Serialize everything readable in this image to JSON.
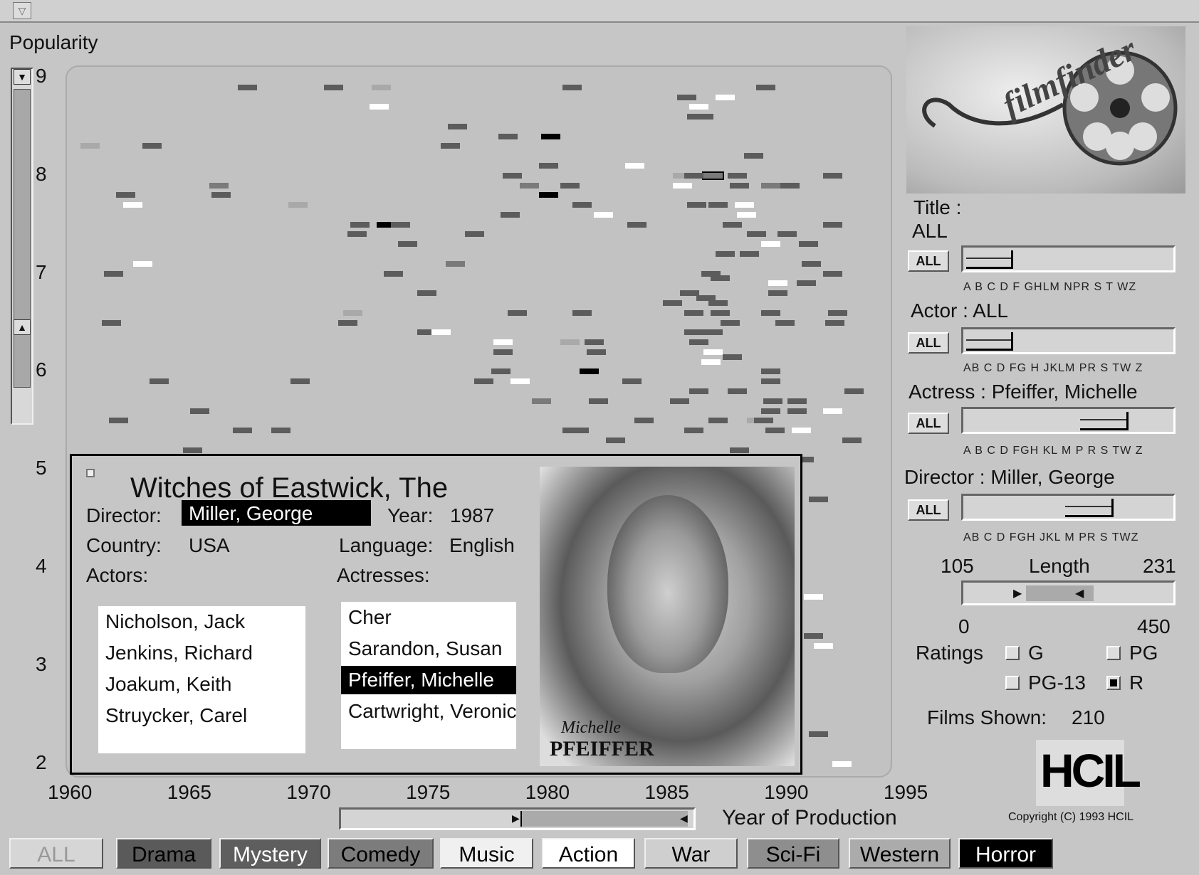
{
  "window": {
    "menu_icon": "dropdown-arrow-icon"
  },
  "chart_data": {
    "type": "scatter",
    "ylabel": "Popularity",
    "xlabel": "Year of Production",
    "xlim": [
      1960,
      1995
    ],
    "ylim": [
      2,
      9
    ],
    "x_ticks": [
      "1960",
      "1965",
      "1970",
      "1975",
      "1980",
      "1985",
      "1990",
      "1995"
    ],
    "y_ticks": [
      "9",
      "8",
      "7",
      "6",
      "5",
      "4",
      "3",
      "2"
    ],
    "shade_colors": {
      "d": "#5c5c5c",
      "m": "#7a7a7a",
      "l": "#a9a9a9",
      "w": "#ffffff",
      "k": "#000000"
    },
    "points": [
      [
        1960.8,
        8.3,
        "l"
      ],
      [
        1967.4,
        8.9,
        "d"
      ],
      [
        1971.0,
        8.9,
        "d"
      ],
      [
        1973.0,
        8.9,
        "l"
      ],
      [
        1972.9,
        8.7,
        "w"
      ],
      [
        1963.4,
        8.3,
        "d"
      ],
      [
        1962.3,
        7.8,
        "d"
      ],
      [
        1962.6,
        7.7,
        "w"
      ],
      [
        1966.2,
        7.9,
        "m"
      ],
      [
        1966.3,
        7.8,
        "d"
      ],
      [
        1969.5,
        7.7,
        "l"
      ],
      [
        1961.8,
        7.0,
        "d"
      ],
      [
        1963.0,
        7.1,
        "w"
      ],
      [
        1961.7,
        6.5,
        "d"
      ],
      [
        1963.7,
        5.9,
        "d"
      ],
      [
        1965.4,
        5.6,
        "d"
      ],
      [
        1962.0,
        5.5,
        "d"
      ],
      [
        1967.2,
        5.4,
        "d"
      ],
      [
        1968.8,
        5.4,
        "d"
      ],
      [
        1969.6,
        5.9,
        "d"
      ],
      [
        1965.1,
        5.2,
        "d"
      ],
      [
        1976.2,
        8.5,
        "d"
      ],
      [
        1975.9,
        8.3,
        "d"
      ],
      [
        1978.3,
        8.4,
        "d"
      ],
      [
        1980.1,
        8.4,
        "k"
      ],
      [
        1981.0,
        8.9,
        "d"
      ],
      [
        1980.0,
        8.1,
        "d"
      ],
      [
        1978.5,
        8.0,
        "d"
      ],
      [
        1979.2,
        7.9,
        "m"
      ],
      [
        1980.0,
        7.8,
        "k"
      ],
      [
        1980.9,
        7.9,
        "d"
      ],
      [
        1983.6,
        8.1,
        "w"
      ],
      [
        1978.4,
        7.6,
        "d"
      ],
      [
        1982.3,
        7.6,
        "w"
      ],
      [
        1983.7,
        7.5,
        "d"
      ],
      [
        1981.4,
        7.7,
        "d"
      ],
      [
        1973.2,
        7.5,
        "k"
      ],
      [
        1972.1,
        7.5,
        "d"
      ],
      [
        1972.0,
        7.4,
        "d"
      ],
      [
        1973.8,
        7.5,
        "d"
      ],
      [
        1974.1,
        7.3,
        "d"
      ],
      [
        1973.5,
        7.0,
        "d"
      ],
      [
        1976.9,
        7.4,
        "d"
      ],
      [
        1976.1,
        7.1,
        "m"
      ],
      [
        1974.9,
        6.8,
        "d"
      ],
      [
        1971.8,
        6.6,
        "l"
      ],
      [
        1971.6,
        6.5,
        "d"
      ],
      [
        1974.9,
        6.4,
        "d"
      ],
      [
        1975.5,
        6.4,
        "w"
      ],
      [
        1978.7,
        6.6,
        "d"
      ],
      [
        1981.4,
        6.6,
        "d"
      ],
      [
        1978.1,
        6.3,
        "w"
      ],
      [
        1978.1,
        6.2,
        "d"
      ],
      [
        1980.9,
        6.3,
        "l"
      ],
      [
        1981.9,
        6.3,
        "d"
      ],
      [
        1982.0,
        6.2,
        "d"
      ],
      [
        1981.7,
        6.0,
        "k"
      ],
      [
        1978.0,
        6.0,
        "d"
      ],
      [
        1977.3,
        5.9,
        "d"
      ],
      [
        1978.8,
        5.9,
        "w"
      ],
      [
        1979.7,
        5.7,
        "m"
      ],
      [
        1982.1,
        5.7,
        "d"
      ],
      [
        1983.5,
        5.9,
        "d"
      ],
      [
        1981.3,
        5.4,
        "d"
      ],
      [
        1981.0,
        5.4,
        "d"
      ],
      [
        1982.8,
        5.3,
        "d"
      ],
      [
        1984.0,
        5.5,
        "d"
      ],
      [
        1985.8,
        8.8,
        "d"
      ],
      [
        1986.3,
        8.7,
        "w"
      ],
      [
        1987.4,
        8.8,
        "w"
      ],
      [
        1989.1,
        8.9,
        "d"
      ],
      [
        1986.2,
        8.6,
        "d"
      ],
      [
        1986.5,
        8.6,
        "d"
      ],
      [
        1986.9,
        8.0,
        "m"
      ],
      [
        1988.6,
        8.2,
        "d"
      ],
      [
        1985.6,
        8.0,
        "l"
      ],
      [
        1986.1,
        8.0,
        "d"
      ],
      [
        1987.9,
        8.0,
        "d"
      ],
      [
        1991.9,
        8.0,
        "d"
      ],
      [
        1985.6,
        7.9,
        "w"
      ],
      [
        1988.0,
        7.9,
        "d"
      ],
      [
        1989.3,
        7.9,
        "m"
      ],
      [
        1990.1,
        7.9,
        "d"
      ],
      [
        1986.2,
        7.7,
        "d"
      ],
      [
        1987.1,
        7.7,
        "d"
      ],
      [
        1988.2,
        7.7,
        "w"
      ],
      [
        1988.3,
        7.6,
        "w"
      ],
      [
        1987.7,
        7.5,
        "d"
      ],
      [
        1988.7,
        7.4,
        "d"
      ],
      [
        1989.3,
        7.3,
        "w"
      ],
      [
        1990.0,
        7.4,
        "d"
      ],
      [
        1991.9,
        7.5,
        "d"
      ],
      [
        1990.9,
        7.3,
        "d"
      ],
      [
        1987.4,
        7.2,
        "d"
      ],
      [
        1988.4,
        7.2,
        "d"
      ],
      [
        1991.0,
        7.1,
        "d"
      ],
      [
        1991.9,
        7.0,
        "d"
      ],
      [
        1986.8,
        7.0,
        "d"
      ],
      [
        1987.2,
        6.95,
        "d"
      ],
      [
        1989.6,
        6.9,
        "w"
      ],
      [
        1990.8,
        6.9,
        "d"
      ],
      [
        1985.9,
        6.8,
        "d"
      ],
      [
        1989.6,
        6.8,
        "d"
      ],
      [
        1986.6,
        6.75,
        "d"
      ],
      [
        1985.2,
        6.7,
        "d"
      ],
      [
        1986.1,
        6.6,
        "d"
      ],
      [
        1987.1,
        6.7,
        "d"
      ],
      [
        1987.2,
        6.6,
        "d"
      ],
      [
        1989.3,
        6.6,
        "d"
      ],
      [
        1989.9,
        6.5,
        "d"
      ],
      [
        1992.1,
        6.6,
        "d"
      ],
      [
        1992.0,
        6.5,
        "d"
      ],
      [
        1987.6,
        6.5,
        "d"
      ],
      [
        1986.1,
        6.4,
        "d"
      ],
      [
        1986.9,
        6.4,
        "d"
      ],
      [
        1986.3,
        6.3,
        "d"
      ],
      [
        1986.9,
        6.2,
        "w"
      ],
      [
        1987.7,
        6.15,
        "d"
      ],
      [
        1986.8,
        6.1,
        "w"
      ],
      [
        1989.3,
        6.0,
        "d"
      ],
      [
        1989.3,
        5.9,
        "d"
      ],
      [
        1987.9,
        5.8,
        "d"
      ],
      [
        1985.5,
        5.7,
        "d"
      ],
      [
        1986.3,
        5.8,
        "d"
      ],
      [
        1989.4,
        5.7,
        "d"
      ],
      [
        1990.4,
        5.7,
        "d"
      ],
      [
        1990.4,
        5.6,
        "d"
      ],
      [
        1989.3,
        5.6,
        "d"
      ],
      [
        1991.9,
        5.6,
        "w"
      ],
      [
        1992.8,
        5.8,
        "d"
      ],
      [
        1988.7,
        5.5,
        "l"
      ],
      [
        1989.0,
        5.5,
        "d"
      ],
      [
        1989.5,
        5.4,
        "d"
      ],
      [
        1990.6,
        5.4,
        "w"
      ],
      [
        1987.1,
        5.5,
        "d"
      ],
      [
        1986.1,
        5.4,
        "d"
      ],
      [
        1992.7,
        5.3,
        "d"
      ],
      [
        1988.0,
        5.2,
        "d"
      ],
      [
        1990.7,
        5.1,
        "d"
      ],
      [
        1991.3,
        4.7,
        "d"
      ],
      [
        1991.1,
        3.7,
        "w"
      ],
      [
        1991.1,
        3.3,
        "d"
      ],
      [
        1991.5,
        3.2,
        "w"
      ],
      [
        1991.3,
        2.3,
        "d"
      ],
      [
        1992.3,
        2.0,
        "w"
      ]
    ],
    "selected_point": [
      1986.9,
      8.0
    ]
  },
  "details": {
    "title": "Witches of Eastwick, The",
    "director_label": "Director:",
    "director": "Miller, George",
    "year_label": "Year:",
    "year": "1987",
    "country_label": "Country:",
    "country": "USA",
    "language_label": "Language:",
    "language": "English",
    "actors_label": "Actors:",
    "actresses_label": "Actresses:",
    "actors": [
      "Nicholson, Jack",
      "Jenkins, Richard",
      "Joakum, Keith",
      "Struycker, Carel"
    ],
    "actresses": [
      "Cher",
      "Sarandon, Susan",
      "Pfeiffer, Michelle",
      "Cartwright, Veronica"
    ],
    "selected_actress": "Pfeiffer, Michelle",
    "photo_caption_1": "Michelle",
    "photo_caption_2": "PFEIFFER"
  },
  "logo": {
    "text": "filmfinder"
  },
  "filters": {
    "title_label": "Title :",
    "title_value": "ALL",
    "actor_label": "Actor : ALL",
    "actress_label": "Actress : Pfeiffer, Michelle",
    "director_label": "Director : Miller, George",
    "all_button": "ALL",
    "title_letters": "A B C D F GHLM NPR S  T  WZ",
    "actor_letters": "AB  C  D FG H JKLM  PR S  TW Z",
    "actress_letters": "A B  C  D FGH KL M  P R S  TW Z",
    "director_letters": "AB  C  D FGH JKL M  PR S  TWZ",
    "length_label": "Length",
    "length_min": "105",
    "length_max": "231",
    "length_range_min": "0",
    "length_range_max": "450",
    "ratings_label": "Ratings",
    "ratings": [
      {
        "label": "G",
        "checked": false
      },
      {
        "label": "PG",
        "checked": false
      },
      {
        "label": "PG-13",
        "checked": false
      },
      {
        "label": "R",
        "checked": true
      }
    ],
    "films_shown_label": "Films Shown:",
    "films_shown": "210"
  },
  "hcil": {
    "logo": "HCIL",
    "copyright": "Copyright (C) 1993 HCIL"
  },
  "genres": [
    {
      "label": "ALL",
      "bg": "#d6d6d6",
      "fg": "#999999"
    },
    {
      "label": "Drama",
      "bg": "#5a5a5a",
      "fg": "#000000"
    },
    {
      "label": "Mystery",
      "bg": "#5e5e5e",
      "fg": "#ffffff"
    },
    {
      "label": "Comedy",
      "bg": "#7c7c7c",
      "fg": "#000000"
    },
    {
      "label": "Music",
      "bg": "#f0f0f0",
      "fg": "#000000"
    },
    {
      "label": "Action",
      "bg": "#ffffff",
      "fg": "#000000"
    },
    {
      "label": "War",
      "bg": "#cfcfcf",
      "fg": "#000000"
    },
    {
      "label": "Sci-Fi",
      "bg": "#8e8e8e",
      "fg": "#000000"
    },
    {
      "label": "Western",
      "bg": "#ababab",
      "fg": "#000000"
    },
    {
      "label": "Horror",
      "bg": "#000000",
      "fg": "#ffffff"
    }
  ]
}
